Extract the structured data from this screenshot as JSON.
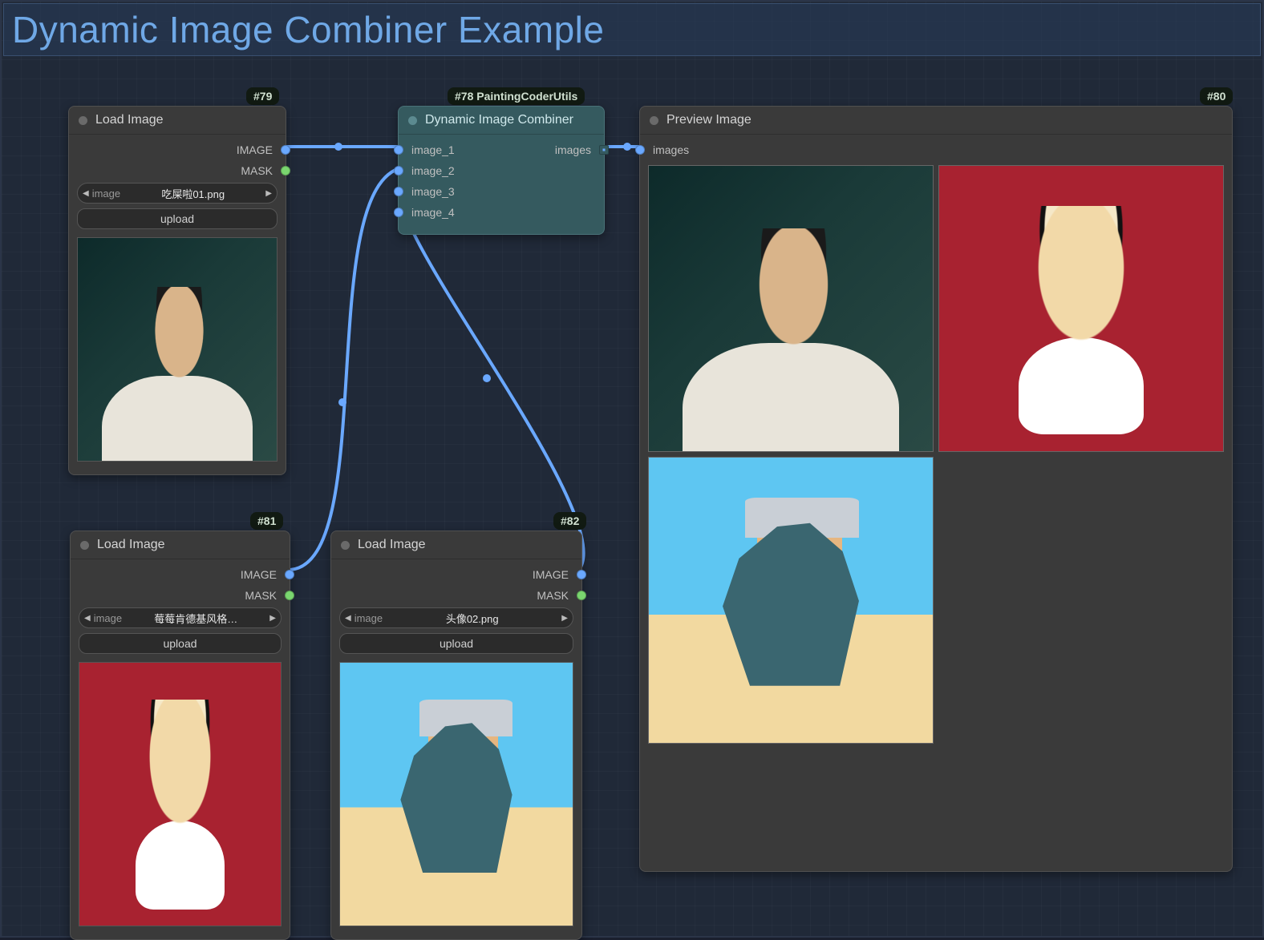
{
  "title": "Dynamic Image Combiner Example",
  "badges": {
    "n79": "#79",
    "n78": "#78 PaintingCoderUtils",
    "n80": "#80",
    "n81": "#81",
    "n82": "#82"
  },
  "nodes": {
    "load1": {
      "title": "Load Image",
      "out_image": "IMAGE",
      "out_mask": "MASK",
      "file_label": "image",
      "file_value": "吃屎啦01.png",
      "upload": "upload"
    },
    "load2": {
      "title": "Load Image",
      "out_image": "IMAGE",
      "out_mask": "MASK",
      "file_label": "image",
      "file_value": "莓莓肯德基风格…",
      "upload": "upload"
    },
    "load3": {
      "title": "Load Image",
      "out_image": "IMAGE",
      "out_mask": "MASK",
      "file_label": "image",
      "file_value": "头像02.png",
      "upload": "upload"
    },
    "combiner": {
      "title": "Dynamic Image Combiner",
      "in1": "image_1",
      "in2": "image_2",
      "in3": "image_3",
      "in4": "image_4",
      "out": "images"
    },
    "preview": {
      "title": "Preview Image",
      "in": "images"
    }
  }
}
